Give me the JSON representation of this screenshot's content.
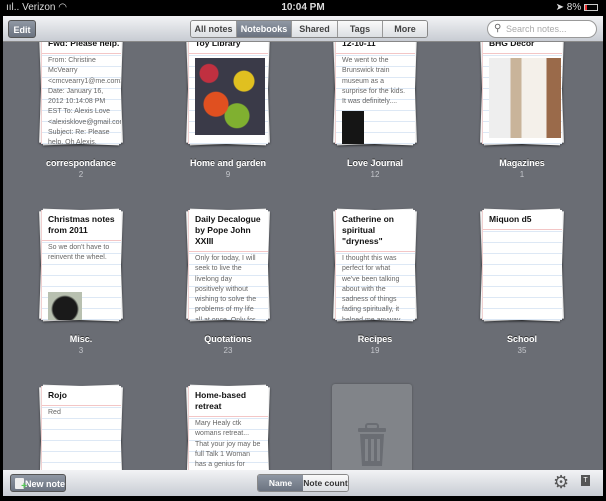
{
  "status": {
    "carrier": "Verizon",
    "time": "10:04 PM",
    "battery": "8%"
  },
  "toolbar": {
    "edit": "Edit",
    "tabs": [
      "All notes",
      "Notebooks",
      "Shared",
      "Tags",
      "More"
    ],
    "active_tab": "Notebooks",
    "search_placeholder": "Search notes..."
  },
  "notebooks": [
    {
      "name": "correspondance",
      "count": "2",
      "note_title": "Fwd: Please help.",
      "note_text": "From: Christine McVearry <cmcvearry1@me.com> Date: January 16, 2012 10:14:08 PM EST To: Alexis Love <alexisklove@gmail.com> Subject: Re: Please help. Oh Alexis, you..."
    },
    {
      "name": "Home and garden",
      "count": "9",
      "note_title": "Toy Library",
      "note_text": ""
    },
    {
      "name": "Love Journal",
      "count": "12",
      "note_title": "12-10-11",
      "note_text": "We went to the Brunswick train museum as a surprise for the kids. It was definitely...."
    },
    {
      "name": "Magazines",
      "count": "1",
      "note_title": "BHG Decor",
      "note_text": ""
    },
    {
      "name": "Misc.",
      "count": "3",
      "note_title": "Christmas notes from 2011",
      "note_text": "So we don't have to reinvent the wheel."
    },
    {
      "name": "Quotations",
      "count": "23",
      "note_title": "Daily Decalogue by Pope John XXIII",
      "note_text": "Only for today, I will seek to live the livelong day positively without wishing to solve the problems of my life all at once. Only for today, I will take the greatest care of my appearance: I will dress modestly; I..."
    },
    {
      "name": "Recipes",
      "count": "19",
      "note_title": "Catherine on spiritual \"dryness\"",
      "note_text": "I thought this was perfect for what we've been talking about with the sadness of things fading spiritually, it helped me anyway, so I thought I'd pass it along. This is actually what God is telling her dire..."
    },
    {
      "name": "School",
      "count": "35",
      "note_title": "Miquon d5",
      "note_text": ""
    },
    {
      "name": "",
      "count": "",
      "note_title": "Rojo",
      "note_text": "Red"
    },
    {
      "name": "",
      "count": "",
      "note_title": "Home-based retreat",
      "note_text": "Mary Healy ctk womans retreat... That your joy may be full Talk 1 Woman has a genius for placing the person first. The primacy of person"
    }
  ],
  "bottombar": {
    "new_note": "New note",
    "sort": [
      "Name",
      "Note count"
    ],
    "active_sort": "Name"
  }
}
